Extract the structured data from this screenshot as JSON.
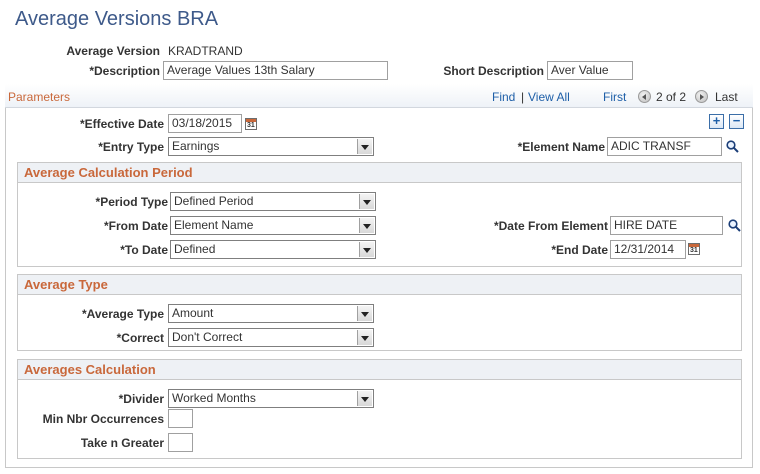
{
  "page": {
    "title": "Average Versions BRA",
    "average_version_label": "Average Version",
    "average_version_value": "KRADTRAND",
    "description_label": "*Description",
    "description_value": "Average Values 13th Salary",
    "short_description_label": "Short Description",
    "short_description_value": "Aver Value"
  },
  "parameters": {
    "title": "Parameters",
    "find": "Find",
    "separator": "|",
    "view_all": "View All",
    "first": "First",
    "count": "2 of 2",
    "last": "Last",
    "effective_date_label": "*Effective Date",
    "effective_date_value": "03/18/2015",
    "entry_type_label": "*Entry Type",
    "entry_type_value": "Earnings",
    "element_name_label": "*Element Name",
    "element_name_value": "ADIC TRANSF",
    "add_row": "+",
    "delete_row": "−"
  },
  "average_calculation_period": {
    "title": "Average Calculation Period",
    "period_type_label": "*Period Type",
    "period_type_value": "Defined Period",
    "from_date_label": "*From Date",
    "from_date_value": "Element Name",
    "date_from_element_label": "*Date From Element",
    "date_from_element_value": "HIRE DATE",
    "to_date_label": "*To Date",
    "to_date_value": "Defined",
    "end_date_label": "*End Date",
    "end_date_value": "12/31/2014"
  },
  "average_type": {
    "title": "Average Type",
    "average_type_label": "*Average Type",
    "average_type_value": "Amount",
    "correct_label": "*Correct",
    "correct_value": "Don't Correct"
  },
  "averages_calculation": {
    "title": "Averages Calculation",
    "divider_label": "*Divider",
    "divider_value": "Worked Months",
    "min_nbr_label": "Min Nbr Occurrences",
    "min_nbr_value": "",
    "take_n_label": "Take n Greater",
    "take_n_value": ""
  },
  "icons": {
    "calendar": "calendar-icon",
    "lookup": "magnifier-icon",
    "calendar_glyph": "31"
  },
  "colors": {
    "title": "#3e5a8a",
    "section_header": "#c9683b",
    "link": "#1e5fa8"
  }
}
